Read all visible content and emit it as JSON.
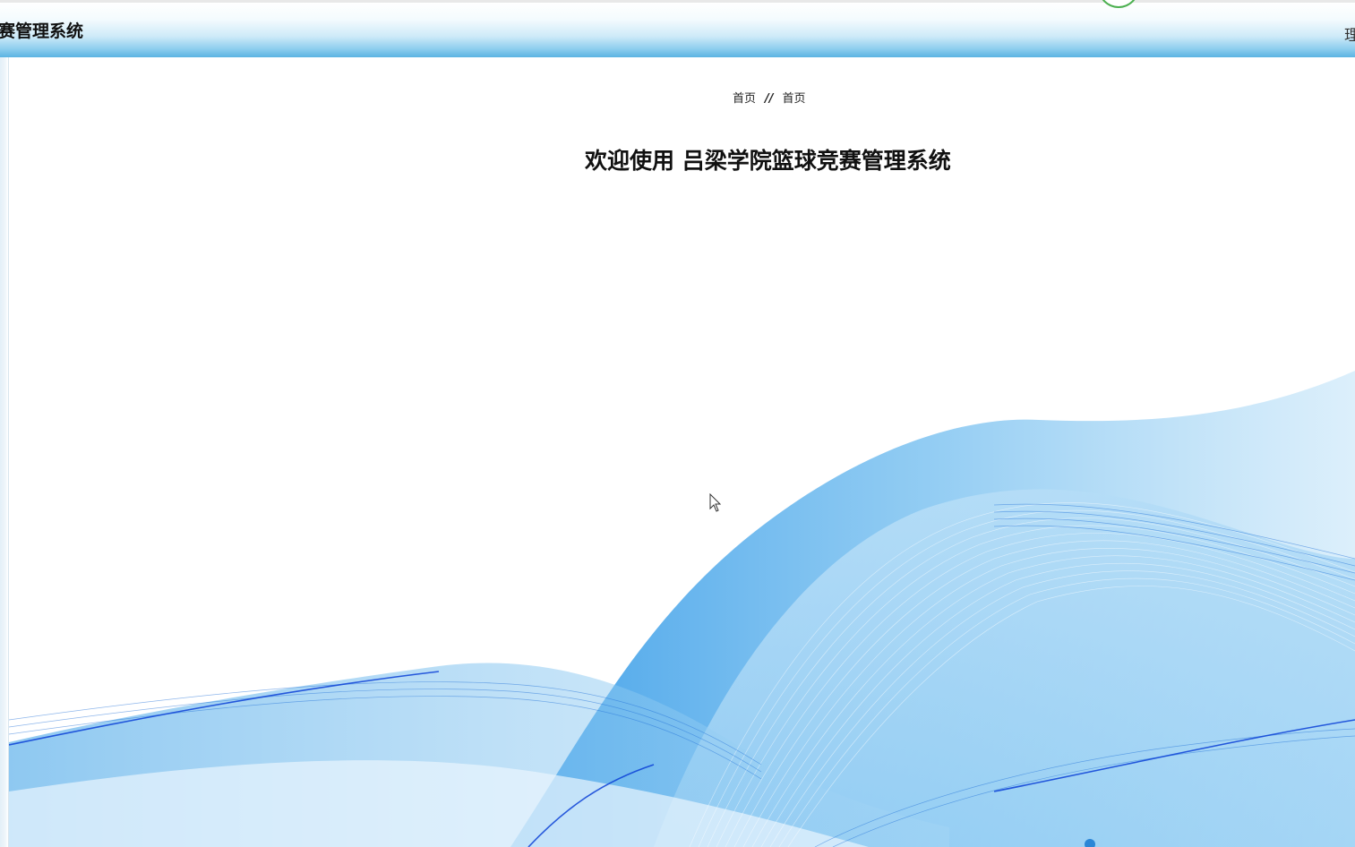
{
  "header": {
    "title": "赛管理系统",
    "right_text": "理"
  },
  "breadcrumb": {
    "home": "首页",
    "separator": "//",
    "current": "首页"
  },
  "main": {
    "welcome": "欢迎使用 吕梁学院篮球竞赛管理系统"
  },
  "colors": {
    "header_accent": "#5bb3e2",
    "wave_blue": "#1e88e5",
    "wave_dark": "#0a3fd6"
  }
}
